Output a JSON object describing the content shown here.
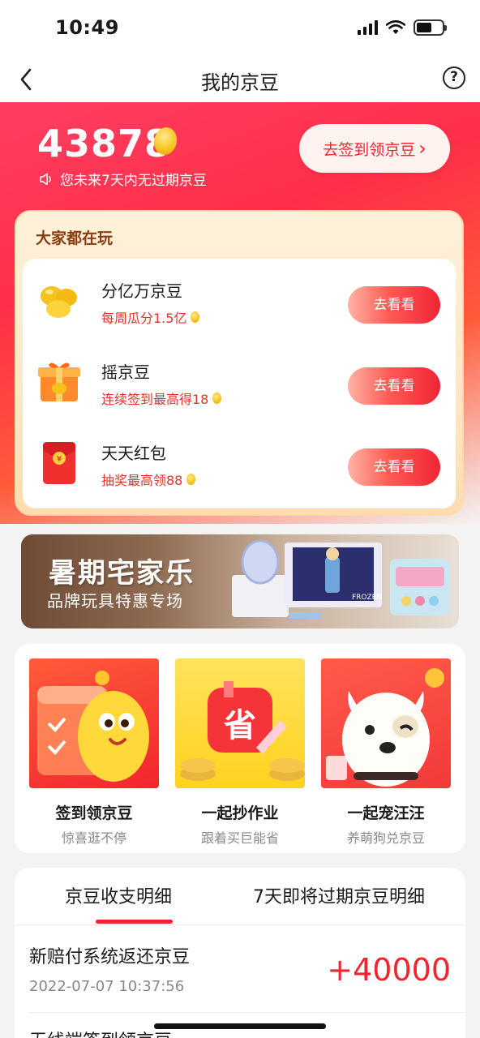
{
  "status_bar": {
    "time": "10:49"
  },
  "nav": {
    "title": "我的京豆",
    "help_glyph": "?"
  },
  "summary": {
    "bean_count": "43878",
    "expire_note": "您未来7天内无过期京豆",
    "sign_button": "去签到领京豆",
    "sign_chevron": "›"
  },
  "play_section": {
    "title": "大家都在玩",
    "items": [
      {
        "name": "分亿万京豆",
        "sub": "每周瓜分1.5亿",
        "button": "去看看",
        "icon": "beans-icon"
      },
      {
        "name": "摇京豆",
        "sub": "连续签到最高得18",
        "button": "去看看",
        "icon": "gift-box-icon"
      },
      {
        "name": "天天红包",
        "sub": "抽奖最高领88",
        "button": "去看看",
        "icon": "red-envelope-icon"
      }
    ]
  },
  "banner": {
    "title": "暑期宅家乐",
    "subtitle": "品牌玩具特惠专场",
    "product_label": "FROZEN"
  },
  "activities": [
    {
      "name": "签到领京豆",
      "sub": "惊喜逛不停",
      "icon": "bean-mascot-calendar-icon"
    },
    {
      "name": "一起抄作业",
      "sub": "跟着买巨能省",
      "icon": "save-money-icon",
      "pic_text": "省"
    },
    {
      "name": "一起宠汪汪",
      "sub": "养萌狗兑京豆",
      "icon": "dog-mascot-icon"
    }
  ],
  "records": {
    "tabs": [
      "京豆收支明细",
      "7天即将过期京豆明细"
    ],
    "active_tab": 0,
    "items": [
      {
        "title": "新赔付系统返还京豆",
        "time": "2022-07-07 10:37:56",
        "amount": "+40000"
      },
      {
        "title": "无线端签到领京豆"
      }
    ]
  },
  "colors": {
    "brand_red": "#f0252f",
    "hero_start": "#ff3e63",
    "bean_gold": "#f5c21b"
  }
}
